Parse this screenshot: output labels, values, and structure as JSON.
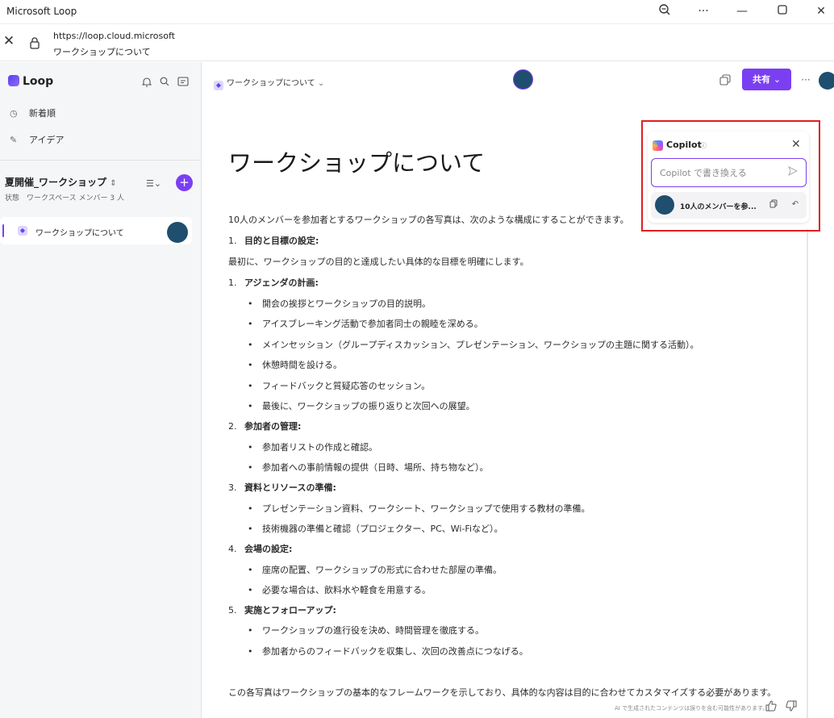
{
  "window": {
    "title": "Microsoft Loop",
    "zoom_icon": "zoom-icon",
    "more_icon": "more-icon",
    "minimize_icon": "minimize-icon",
    "maximize_icon": "maximize-icon",
    "close_icon": "close-icon"
  },
  "address_bar": {
    "url": "https://loop.cloud.microsoft",
    "page_title": "ワークショップについて"
  },
  "sidebar": {
    "app_name": "Loop",
    "nav": [
      {
        "label": "新着順",
        "icon": "clock-icon"
      },
      {
        "label": "アイデア",
        "icon": "pen-icon"
      }
    ],
    "workspace": {
      "name": "夏開催_ワークショップ",
      "sub": "状態　ワークスペース メンバー 3 人"
    },
    "pages": [
      {
        "label": "ワークショップについて"
      }
    ]
  },
  "header": {
    "breadcrumb": "ワークショップについて",
    "share_label": "共有",
    "more_label": "···"
  },
  "document": {
    "title": "ワークショップについて",
    "intro": "10人のメンバーを参加者とするワークショップの各写真は、次のような構成にすることができます。",
    "sections": [
      {
        "num": "1.",
        "heading": "目的と目標の設定:",
        "text": "最初に、ワークショップの目的と達成したい具体的な目標を明確にします。",
        "items": []
      },
      {
        "num": "1.",
        "heading": "アジェンダの計画:",
        "items": [
          "開会の挨拶とワークショップの目的説明。",
          "アイスブレーキング活動で参加者同士の親睦を深める。",
          "メインセッション（グループディスカッション、プレゼンテーション、ワークショップの主題に関する活動）。",
          "休憩時間を設ける。",
          "フィードバックと質疑応答のセッション。",
          "最後に、ワークショップの振り返りと次回への展望。"
        ]
      },
      {
        "num": "2.",
        "heading": "参加者の管理:",
        "items": [
          "参加者リストの作成と確認。",
          "参加者への事前情報の提供（日時、場所、持ち物など）。"
        ]
      },
      {
        "num": "3.",
        "heading": "資料とリソースの準備:",
        "items": [
          "プレゼンテーション資料、ワークシート、ワークショップで使用する教材の準備。",
          "技術機器の準備と確認（プロジェクター、PC、Wi-Fiなど）。"
        ]
      },
      {
        "num": "4.",
        "heading": "会場の設定:",
        "items": [
          "座席の配置、ワークショップの形式に合わせた部屋の準備。",
          "必要な場合は、飲料水や軽食を用意する。"
        ]
      },
      {
        "num": "5.",
        "heading": "実施とフォローアップ:",
        "items": [
          "ワークショップの進行役を決め、時間管理を徹底する。",
          "参加者からのフィードバックを収集し、次回の改善点につなげる。"
        ]
      }
    ],
    "closing": "この各写真はワークショップの基本的なフレームワークを示しており、具体的な内容は目的に合わせてカスタマイズする必要があります。",
    "footnote": "AI で生成されたコンテンツは誤りを含む可能性があります。"
  },
  "copilot": {
    "title": "Copilot",
    "info": "ⓘ",
    "input_placeholder": "Copilot で書き換える",
    "result_text": "10人のメンバーを参..."
  },
  "colors": {
    "accent": "#7b3ff2",
    "highlight_border": "#e02020",
    "avatar": "#1f4e6e"
  }
}
